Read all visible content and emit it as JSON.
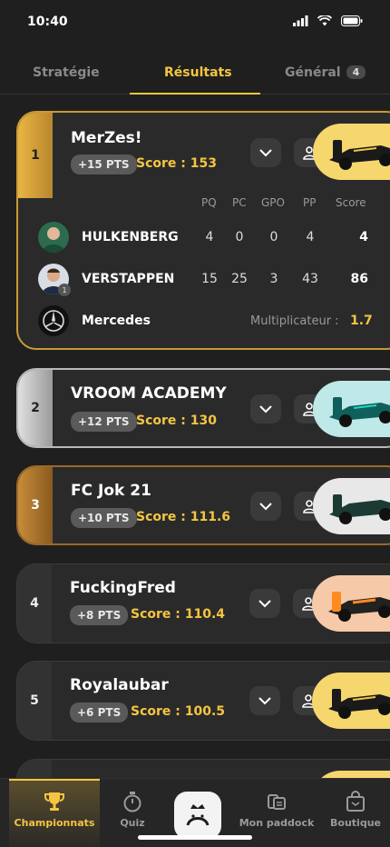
{
  "status": {
    "time": "10:40"
  },
  "tabs": [
    {
      "label": "Stratégie"
    },
    {
      "label": "Résultats"
    },
    {
      "label": "Général",
      "badge": "4"
    }
  ],
  "teams": [
    {
      "rank": "1",
      "name": "MerZes!",
      "pts": "+15 PTS",
      "score": "Score : 153",
      "car_color": "#f5d76e",
      "details": {
        "headers": [
          "PQ",
          "PC",
          "GPO",
          "PP",
          "Score"
        ],
        "drivers": [
          {
            "name": "HULKENBERG",
            "pq": "4",
            "pc": "0",
            "gpo": "0",
            "pp": "4",
            "score": "4"
          },
          {
            "name": "VERSTAPPEN",
            "badge": "1",
            "pq": "15",
            "pc": "25",
            "gpo": "3",
            "pp": "43",
            "score": "86"
          }
        ],
        "constructor": {
          "name": "Mercedes",
          "multiplier_label": "Multiplicateur :",
          "multiplier": "1.7"
        }
      }
    },
    {
      "rank": "2",
      "name": "VROOM ACADEMY",
      "pts": "+12 PTS",
      "score": "Score : 130",
      "car_color": "#bfe8e8"
    },
    {
      "rank": "3",
      "name": "FC Jok 21",
      "pts": "+10 PTS",
      "score": "Score : 111.6",
      "car_color": "#e8e8e8"
    },
    {
      "rank": "4",
      "name": "FuckingFred",
      "pts": "+8 PTS",
      "score": "Score : 110.4",
      "car_color": "#f6c9a8"
    },
    {
      "rank": "5",
      "name": "Royalaubar",
      "pts": "+6 PTS",
      "score": "Score : 100.5",
      "car_color": "#f5d76e"
    }
  ],
  "nav": [
    {
      "label": "Championnats"
    },
    {
      "label": "Quiz"
    },
    {
      "label": "Mon paddock"
    },
    {
      "label": "Boutique"
    }
  ],
  "colors": {
    "accent": "#f5c542",
    "background": "#1f1f1f",
    "card": "#2a2a2a"
  }
}
